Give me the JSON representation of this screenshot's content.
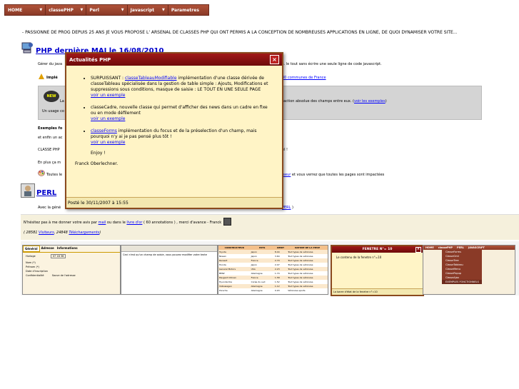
{
  "nav": {
    "items": [
      {
        "label": "HOME"
      },
      {
        "label": "classePHP"
      },
      {
        "label": "Perl"
      },
      {
        "label": "Javascript"
      },
      {
        "label": "Parametres"
      }
    ]
  },
  "intro": "- PASSIONNE DE PROG DEPUIS 25 ANS JE VOUS PROPOSE L' ARSENAL DE CLASSES PHP QUI ONT PERMIS A LA CONCEPTION DE NOMBREUSES APPLICATIONS EN LIGNE, DE QUOI DYNAMISER VOTRE SITE...",
  "php_section": {
    "title": "PHP dernière MAJ le 16/08/2010",
    "line1_start": "Gérer du java",
    "line1_end": "s. le tout sans écrire une seule ligne de code javascript.",
    "line2_start": "Implé",
    "line2_link": "30 communes de France",
    "grey_line": "raction absolue des champs entre eux. (",
    "grey_link": "voir les exemples",
    "grey_line_end": ")",
    "grey_prefix": "La",
    "usage": "Un usage co",
    "examples_label": "Exemples fo",
    "and_finally": "et enfin un ac",
    "classe_php": "CLASSE PHP",
    "classe_php_end": "el !",
    "en_plus": "En plus ça m",
    "toutes_start": "Toutes le",
    "toutes_link": "iseur",
    "toutes_end": " et vous verrez que toutes les pages sont impactées"
  },
  "perl_section": {
    "title": "PERL",
    "line_start": "Avec la géné",
    "line_link": "PERL",
    "line_end": " )"
  },
  "footer": {
    "hesitez": "N'hésitez pas à me donner votre avis par ",
    "mail": "mail",
    "ou_dans": " ou dans le ",
    "livre": "livre d'or",
    "annotations": " ( 60 annotations ) , merci d'avance - Franck",
    "visitors_count": "( 28581 ",
    "visitors_link": "Visiteurs",
    "downloads_count": ", 24848 ",
    "downloads_link": "Téléchargements",
    "close_paren": ")"
  },
  "modal": {
    "title": "Actualités PHP",
    "close": "×",
    "items": [
      {
        "prefix": "SURPUISSANT : ",
        "link": "classeTableauModifiable",
        "text": " implémentation d'une classe dérivée de classeTableau spécialisée dans la gestion de table simple : Ajouts, Modifications et suppressions sous conditions, masque de saisie : LE TOUT EN UNE SEULE PAGE",
        "example": "voir un exemple"
      },
      {
        "prefix": "",
        "link": "",
        "text": "classeCadre, nouvelle classe qui permet d'afficher des news dans un cadre en fixe ou en mode défilement",
        "example": "voir un exemple"
      },
      {
        "prefix": "",
        "link": "classeForms",
        "text": " implémentation du focus et de la préselection d'un champ, mais pourquoi n'y ai je pas pensé plus tôt !",
        "example": "voir un exemple"
      }
    ],
    "enjoy": "Enjoy !",
    "signature": "Franck Oberlechner.",
    "posted": "Posté le 30/11/2007 à 15:55"
  },
  "thumbs": {
    "t1_tabs": [
      "Général",
      "Adresse",
      "Informations"
    ],
    "t1_fields": [
      "Horloge",
      "Nom (*)",
      "Prénom (*)",
      "Date d'inscription",
      "Confidentialité"
    ],
    "t1_time": "07 18 36",
    "t1_checkbox": "Sauve de l'adresse",
    "t2_text": "Ceci n'est qu'un champ de saisie, vous pouvez modifier votre texte",
    "t3_headers": [
      "CONSTRUCTEUR",
      "PAYS",
      "DEBIT",
      "NATURE DE LA PIECE"
    ],
    "t3_rows": [
      [
        "Toyota",
        "Japon",
        "8.44",
        "Tout types de véhicules"
      ],
      [
        "Nissan",
        "Japon",
        "3.64",
        "Tout types de véhicules"
      ],
      [
        "Renault",
        "France",
        "2.70",
        "Tout types de véhicules"
      ],
      [
        "Honda",
        "Japon",
        "2.47",
        "Tout types de véhicules"
      ],
      [
        "General Motors",
        "USA",
        "2.23",
        "Tout types de véhicules"
      ],
      [
        "BMW",
        "Allemagne",
        "1.74",
        "Tout types de véhicules"
      ],
      [
        "Peugeot Citroen",
        "France",
        "1.58",
        "Tout types de véhicules"
      ],
      [
        "Hyundai Kia",
        "Corée du sud",
        "1.52",
        "Tout types de véhicules"
      ],
      [
        "Volkswagen",
        "Allemagne",
        "1.12",
        "Tout types de véhicules"
      ],
      [
        "Porsche",
        "Allemagne",
        "0.93",
        "Véhicules sports"
      ]
    ],
    "t4_title": "FENETRE N°= 10",
    "t4_body": "Le contenu de la fenetre n°=10",
    "t4_footer": "La barre d'état de la fenetre n°=10",
    "t5_tabs": [
      "HOME",
      "classePHP",
      "PERL",
      "JAVASCRIPT"
    ],
    "t5_menu": [
      "ClasseForms",
      "ClasseGrid",
      "ClasseTree",
      "ClasseTableau",
      "ClasseMenu",
      "ClassePopup",
      "ClasseAjax"
    ],
    "t5_bottom": "EXEMPLES FONCTIONNELS"
  },
  "colors": {
    "nav": "#8a3a27",
    "modal_header": "#8a0f0f",
    "link": "#0000ff"
  }
}
